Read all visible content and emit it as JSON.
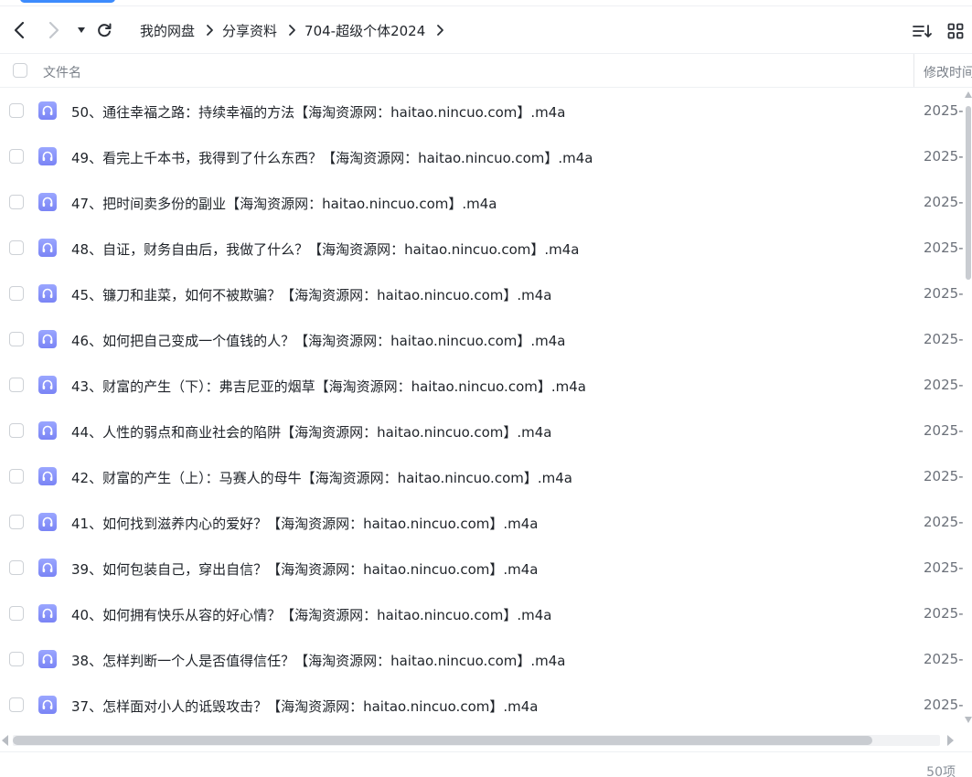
{
  "toolbar": {
    "breadcrumbs": [
      "我的网盘",
      "分享资料",
      "704-超级个体2024"
    ]
  },
  "list_header": {
    "name_label": "文件名",
    "mtime_label": "修改时间"
  },
  "files": [
    {
      "name": "50、通往幸福之路：持续幸福的方法【海淘资源网：haitao.nincuo.com】.m4a",
      "date": "2025-"
    },
    {
      "name": "49、看完上千本书，我得到了什么东西？【海淘资源网：haitao.nincuo.com】.m4a",
      "date": "2025-"
    },
    {
      "name": "47、把时间卖多份的副业【海淘资源网：haitao.nincuo.com】.m4a",
      "date": "2025-"
    },
    {
      "name": "48、自证，财务自由后，我做了什么？【海淘资源网：haitao.nincuo.com】.m4a",
      "date": "2025-"
    },
    {
      "name": "45、镰刀和韭菜，如何不被欺骗？【海淘资源网：haitao.nincuo.com】.m4a",
      "date": "2025-"
    },
    {
      "name": "46、如何把自己变成一个值钱的人？【海淘资源网：haitao.nincuo.com】.m4a",
      "date": "2025-"
    },
    {
      "name": "43、财富的产生（下）：弗吉尼亚的烟草【海淘资源网：haitao.nincuo.com】.m4a",
      "date": "2025-"
    },
    {
      "name": "44、人性的弱点和商业社会的陷阱【海淘资源网：haitao.nincuo.com】.m4a",
      "date": "2025-"
    },
    {
      "name": "42、财富的产生（上）：马赛人的母牛【海淘资源网：haitao.nincuo.com】.m4a",
      "date": "2025-"
    },
    {
      "name": "41、如何找到滋养内心的爱好？【海淘资源网：haitao.nincuo.com】.m4a",
      "date": "2025-"
    },
    {
      "name": "39、如何包装自己，穿出自信？【海淘资源网：haitao.nincuo.com】.m4a",
      "date": "2025-"
    },
    {
      "name": "40、如何拥有快乐从容的好心情？【海淘资源网：haitao.nincuo.com】.m4a",
      "date": "2025-"
    },
    {
      "name": "38、怎样判断一个人是否值得信任？【海淘资源网：haitao.nincuo.com】.m4a",
      "date": "2025-"
    },
    {
      "name": "37、怎样面对小人的诋毁攻击？【海淘资源网：haitao.nincuo.com】.m4a",
      "date": "2025-"
    }
  ],
  "footer": {
    "item_count": "50项"
  },
  "icons": {
    "back": "chevron-left-icon",
    "forward": "chevron-right-icon",
    "history": "caret-down-icon",
    "refresh": "refresh-icon",
    "sort": "sort-list-icon",
    "grid": "grid-view-icon",
    "file": "audio-file-icon"
  },
  "colors": {
    "accent": "#3d8bfd",
    "file_icon": "#8a95fb",
    "text": "#1f2329",
    "muted_text": "#7a8089"
  }
}
